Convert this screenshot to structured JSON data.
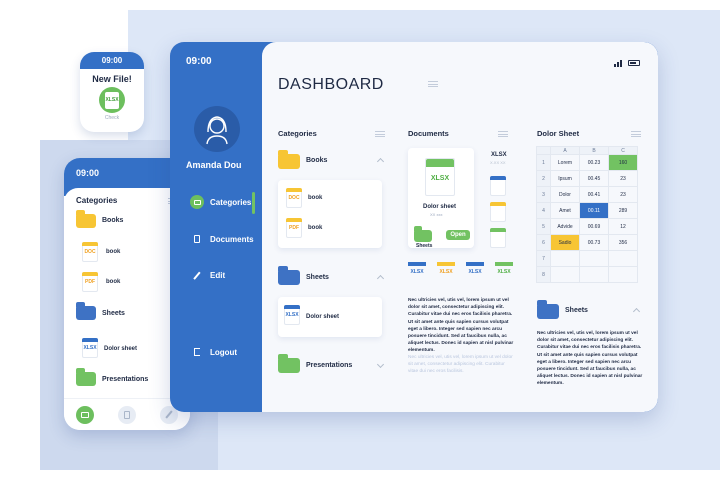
{
  "watch": {
    "time": "09:00",
    "title": "New File!",
    "file_type": "XLSX",
    "action": "Check"
  },
  "phone": {
    "time": "09:00",
    "title": "Categories",
    "folders": [
      {
        "label": "Books",
        "files": [
          {
            "type": "DOC",
            "name": "book"
          },
          {
            "type": "PDF",
            "name": "book"
          }
        ]
      },
      {
        "label": "Sheets",
        "files": [
          {
            "type": "XLSX",
            "name": "Dolor sheet"
          }
        ]
      },
      {
        "label": "Presentations"
      }
    ],
    "nav_icons": [
      "folder-icon",
      "document-icon",
      "edit-icon"
    ]
  },
  "tablet": {
    "time": "09:00",
    "user_name": "Amanda Dou",
    "nav": [
      {
        "label": "Categories",
        "icon": "folder-icon",
        "active": true
      },
      {
        "label": "Documents",
        "icon": "document-icon"
      },
      {
        "label": "Edit",
        "icon": "edit-icon"
      },
      {
        "label": "Logout",
        "icon": "logout-icon"
      }
    ],
    "dashboard_title": "DASHBOARD"
  },
  "categories": {
    "title": "Categories",
    "books_label": "Books",
    "books_files": [
      {
        "type": "DOC",
        "name": "book"
      },
      {
        "type": "PDF",
        "name": "book"
      }
    ],
    "sheets_label": "Sheets",
    "sheets_files": [
      {
        "type": "XLSX",
        "name": "Dolor sheet"
      }
    ],
    "presentations_label": "Presentations"
  },
  "documents": {
    "title": "Documents",
    "featured": {
      "type": "XLSX",
      "name": "Dolor sheet",
      "meta": "XX  xxx"
    },
    "side_file": {
      "type": "XLSX",
      "meta": "X.XX  XX"
    },
    "folder_label": "Sheets",
    "open_button": "Open",
    "mini_files": [
      "XLSX",
      "XLSX",
      "XLSX",
      "XLSX"
    ],
    "paragraph": "Nec ultricies vel, utis vel, lorem ipsum ut vel dolor sit amet, consectetur adipiscing elit. Curabitur vitae dui nec eros facilisis pharetra. Ut sit amet ante quis sapien cursus volutpat eget a libero. Integer sed sapien nec arcu posuere tincidunt. Sed at faucibus nulla, ac aliquet lectus. Donec id sapien at nisl pulvinar elementum.",
    "paragraph_faded": "Nec ultricies vel, utis vel, lorem ipsum ut vel dolor sit amet, consectetur adipiscing elit. Curabitur vitae dui nec eros facilisis."
  },
  "dolor_sheet": {
    "title": "Dolor Sheet",
    "columns": [
      "A",
      "B",
      "C"
    ],
    "rows": [
      [
        "1",
        "Lorem",
        "00.23",
        "160"
      ],
      [
        "2",
        "Ipsum",
        "00.45",
        "23"
      ],
      [
        "3",
        "Dolor",
        "00.41",
        "23"
      ],
      [
        "4",
        "Amet",
        "00.11",
        "289"
      ],
      [
        "5",
        "Advide",
        "00.69",
        "12"
      ],
      [
        "6",
        "Sadio",
        "00.73",
        "356"
      ],
      [
        "7",
        "",
        "",
        ""
      ],
      [
        "8",
        "",
        "",
        ""
      ]
    ],
    "folder_label": "Sheets",
    "paragraph": "Nec ultricies vel, utis vel, lorem ipsum ut vel dolor sit amet, consectetur adipiscing elit. Curabitur vitae dui nec eros facilisis pharetra. Ut sit amet ante quis sapien cursus volutpat eget a libero. Integer sed sapien nec arcu posuere tincidunt. Sed at faucibus nulla, ac aliquet lectus. Donec id sapien at nisl pulvinar elementum."
  },
  "colors": {
    "primary": "#3470c6",
    "green": "#72c262",
    "yellow": "#f7c534",
    "background": "#dde7f7"
  }
}
